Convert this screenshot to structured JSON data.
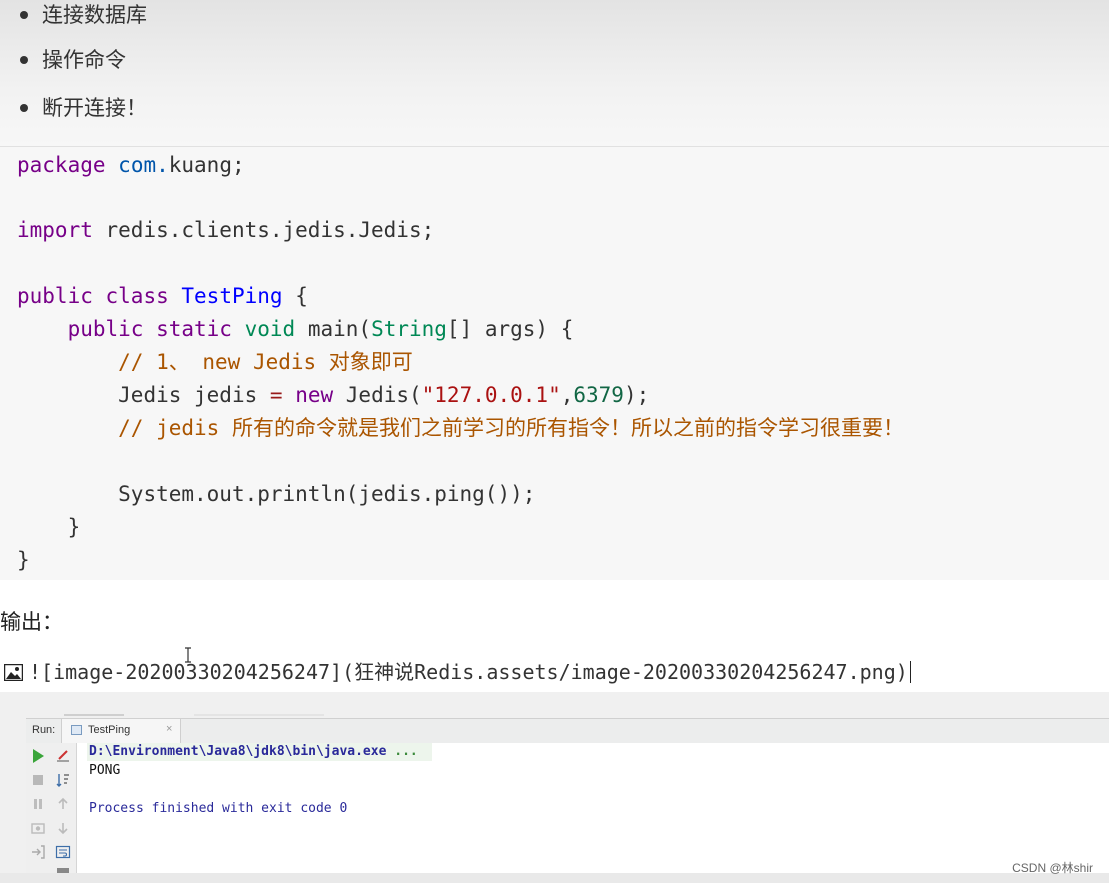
{
  "bullets": [
    "连接数据库",
    "操作命令",
    "断开连接！"
  ],
  "code": {
    "l1": {
      "kw": "package",
      "pkg": "com.",
      "rest": "kuang;"
    },
    "l2": {
      "kw": "import",
      "rest": "redis.clients.jedis.Jedis;"
    },
    "l3": {
      "kw1": "public",
      "kw2": "class",
      "name": "TestPing",
      "rest": "{"
    },
    "l4": {
      "kw1": "public",
      "kw2": "static",
      "kw3": "void",
      "fn": "main(",
      "type": "String",
      "rest": "[] args) {"
    },
    "l5": {
      "comment": "// 1、 new Jedis 对象即可"
    },
    "l6": {
      "a": "Jedis jedis ",
      "eq": "=",
      "kw": "new",
      "b": "Jedis(",
      "str": "\"127.0.0.1\"",
      "c": ",",
      "num": "6379",
      "d": ");"
    },
    "l7": {
      "comment": "// jedis 所有的命令就是我们之前学习的所有指令！所以之前的指令学习很重要！"
    },
    "l8": {
      "text": "System.out.println(jedis.ping());"
    },
    "l9": {
      "text": "}"
    },
    "l10": {
      "text": "}"
    }
  },
  "output_label": "输出：",
  "image_markdown": "![image-20200330204256247](狂神说Redis.assets/image-20200330204256247.png)",
  "ide": {
    "run_label": "Run:",
    "tab_name": "TestPing",
    "tab_close": "×",
    "console": {
      "cmd": "D:\\Environment\\Java8\\jdk8\\bin\\java.exe",
      "cmd_ellipsis": "...",
      "out": "PONG",
      "finished": "Process finished with exit code 0"
    }
  },
  "watermark": "CSDN @林shir",
  "colors": {
    "keyword": "#770088",
    "package": "#0055aa",
    "class_name": "#0000ff",
    "type": "#008855",
    "comment": "#aa5500",
    "string": "#aa1111",
    "number": "#116644",
    "run_green": "#3aa53a"
  }
}
